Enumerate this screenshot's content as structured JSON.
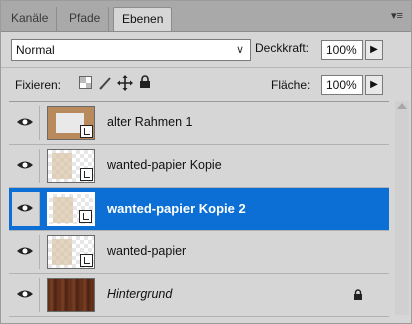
{
  "tabs": [
    {
      "label": "Kanäle"
    },
    {
      "label": "Pfade"
    },
    {
      "label": "Ebenen"
    }
  ],
  "blend_mode": {
    "value": "Normal"
  },
  "opacity": {
    "label": "Deckkraft:",
    "value": "100%"
  },
  "lock": {
    "label": "Fixieren:"
  },
  "fill": {
    "label": "Fläche:",
    "value": "100%"
  },
  "layers": [
    {
      "name": "alter Rahmen 1",
      "visible": true,
      "selected": false,
      "smart_object": true,
      "thumb": "frame"
    },
    {
      "name": "wanted-papier Kopie",
      "visible": true,
      "selected": false,
      "smart_object": true,
      "thumb": "paper"
    },
    {
      "name": "wanted-papier Kopie 2",
      "visible": true,
      "selected": true,
      "smart_object": true,
      "thumb": "paper"
    },
    {
      "name": "wanted-papier",
      "visible": true,
      "selected": false,
      "smart_object": true,
      "thumb": "paper"
    },
    {
      "name": "Hintergrund",
      "visible": true,
      "selected": false,
      "locked": true,
      "smart_object": false,
      "thumb": "wood"
    }
  ],
  "colors": {
    "selection": "#0c6fd6",
    "panel": "#d6d6d6",
    "tabbar": "#a9a9a9"
  }
}
